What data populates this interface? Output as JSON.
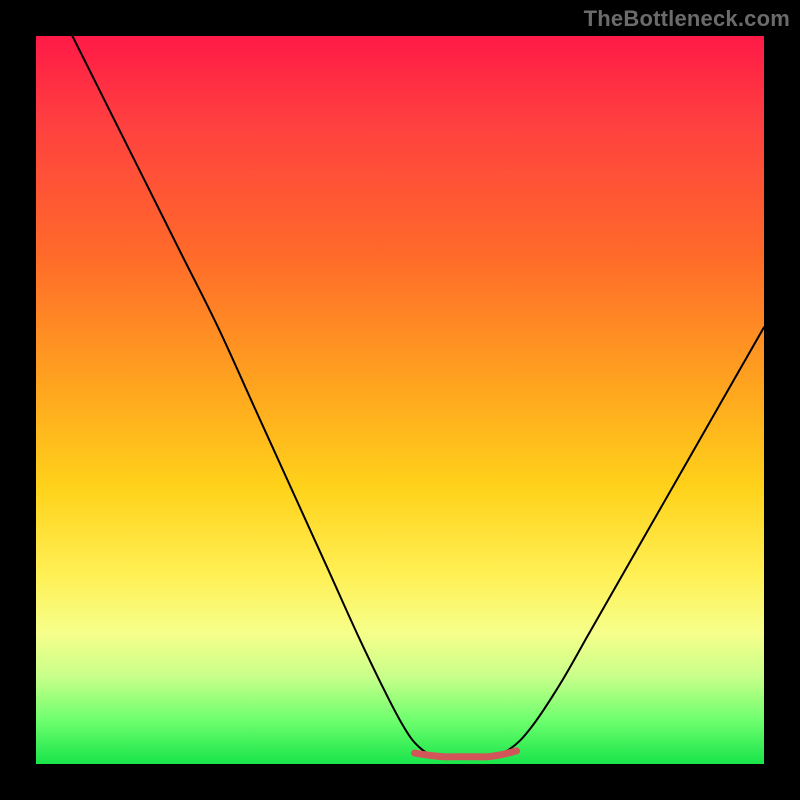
{
  "watermark": "TheBottleneck.com",
  "gradient_colors": {
    "top": "#ff1a47",
    "mid_upper": "#ffa41f",
    "mid_lower": "#fff055",
    "bottom": "#18e44a"
  },
  "curve_style": {
    "stroke": "#000000",
    "stroke_width": 2
  },
  "bottom_marker_style": {
    "stroke": "#d2555a",
    "stroke_width": 7
  },
  "chart_data": {
    "type": "line",
    "title": "",
    "xlabel": "",
    "ylabel": "",
    "xlim": [
      0,
      100
    ],
    "ylim": [
      0,
      100
    ],
    "grid": false,
    "legend": false,
    "series": [
      {
        "name": "bottleneck-curve",
        "x": [
          5,
          10,
          15,
          20,
          25,
          30,
          35,
          40,
          45,
          50,
          53,
          56,
          59,
          62,
          65,
          68,
          72,
          76,
          80,
          84,
          88,
          92,
          96,
          100
        ],
        "values": [
          100,
          90,
          80,
          70,
          60,
          49,
          38,
          27,
          16,
          6,
          2,
          1,
          1,
          1,
          2,
          5,
          11,
          18,
          25,
          32,
          39,
          46,
          53,
          60
        ]
      },
      {
        "name": "optimal-flat-region",
        "x": [
          52,
          54,
          56,
          58,
          60,
          62,
          64,
          66
        ],
        "values": [
          1.5,
          1.2,
          1.0,
          1.0,
          1.0,
          1.0,
          1.3,
          1.8
        ]
      }
    ],
    "annotations": []
  }
}
